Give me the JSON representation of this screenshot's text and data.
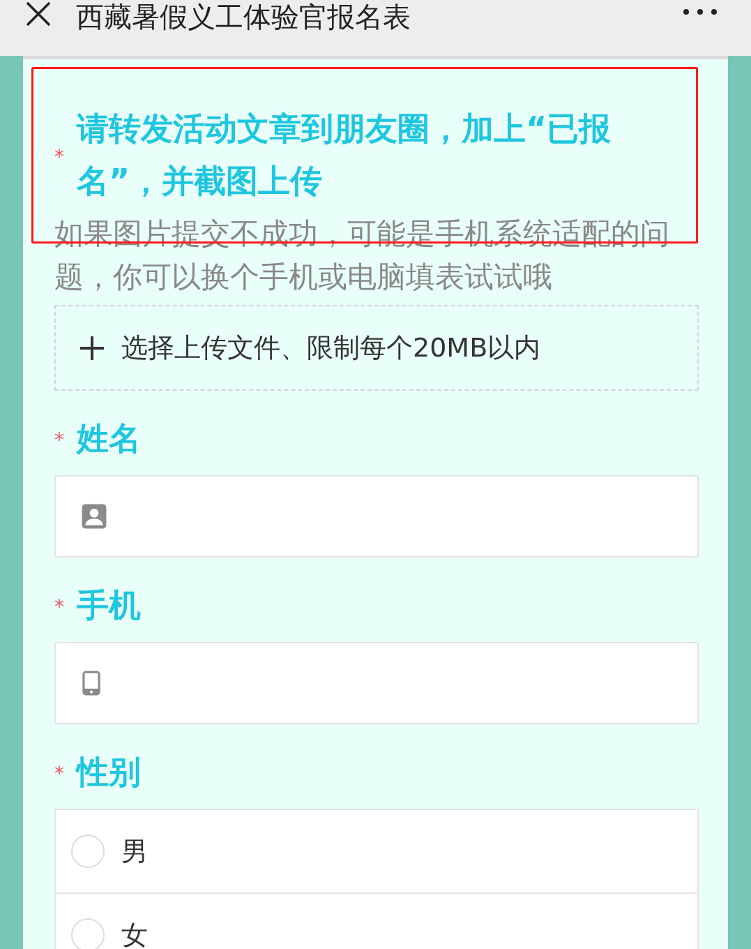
{
  "top_bar": {
    "title": "西藏暑假义工体验官报名表"
  },
  "questions": [
    {
      "kind": "upload",
      "mark": "*",
      "title": "请转发活动文章到朋友圈，加上“已报名”，并截图上传",
      "description": "如果图片提交不成功，可能是手机系统适配的问题，你可以换个手机或电脑填表试试哦",
      "button": "选择上传文件、限制每个20MB以内"
    },
    {
      "kind": "name",
      "mark": "*",
      "title": "姓名"
    },
    {
      "kind": "phone",
      "mark": "*",
      "title": "手机"
    },
    {
      "kind": "choice",
      "mark": "*",
      "title": "性别",
      "options": [
        {
          "label": "男",
          "selected": false
        },
        {
          "label": "女",
          "selected": false
        }
      ]
    }
  ],
  "annotation": {
    "kind": "highlight"
  }
}
